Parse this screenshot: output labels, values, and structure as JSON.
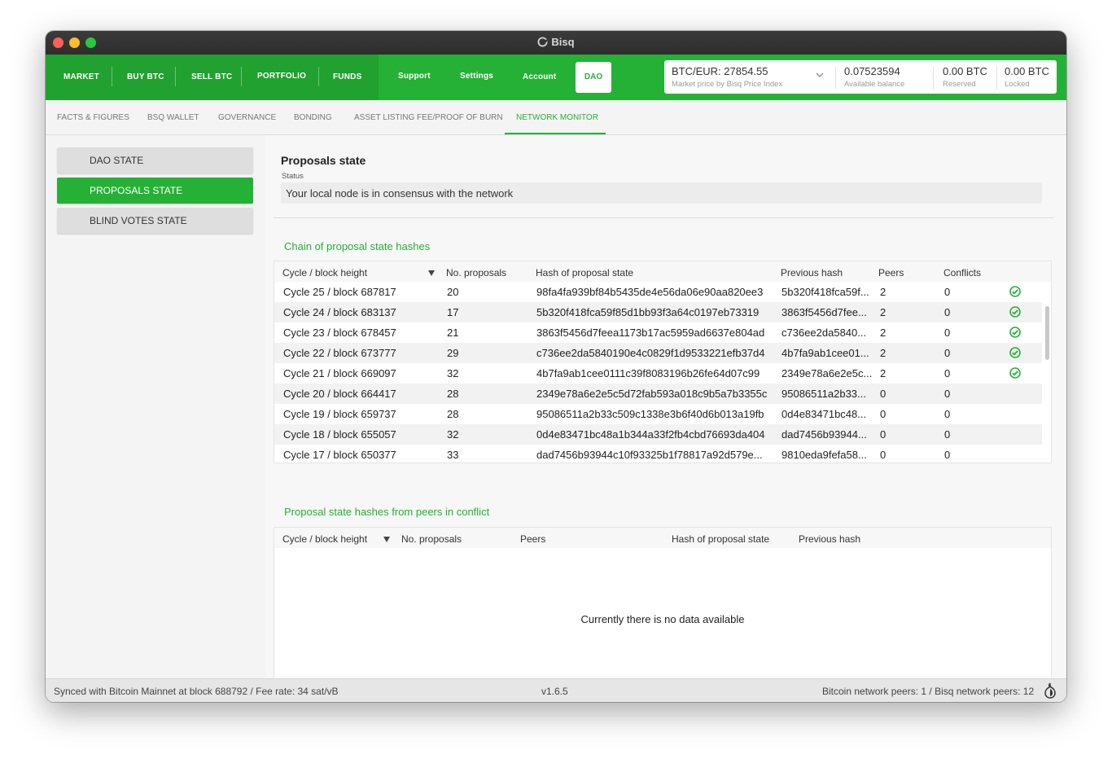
{
  "window": {
    "title": "Bisq"
  },
  "nav": {
    "market": "MARKET",
    "buy": "BUY BTC",
    "sell": "SELL BTC",
    "portfolio": "PORTFOLIO",
    "funds": "FUNDS",
    "support": "Support",
    "settings": "Settings",
    "account": "Account",
    "dao": "DAO"
  },
  "balance": {
    "price": "BTC/EUR: 27854.55",
    "price_sub": "Market price by Bisq Price Index",
    "available": "0.07523594",
    "available_sub": "Available balance",
    "reserved": "0.00 BTC",
    "reserved_sub": "Reserved",
    "locked": "0.00 BTC",
    "locked_sub": "Locked"
  },
  "subtabs": [
    "FACTS & FIGURES",
    "BSQ WALLET",
    "GOVERNANCE",
    "BONDING",
    "ASSET LISTING FEE/PROOF OF BURN",
    "NETWORK MONITOR"
  ],
  "sidebar": [
    "DAO STATE",
    "PROPOSALS STATE",
    "BLIND VOTES STATE"
  ],
  "main": {
    "title": "Proposals state",
    "status_label": "Status",
    "status_value": "Your local node is in consensus with the network",
    "chain_title": "Chain of proposal state hashes",
    "conflict_title": "Proposal state hashes from peers in conflict",
    "empty": "Currently there is no data available"
  },
  "chain_table": {
    "headers": [
      "Cycle / block height",
      "No. proposals",
      "Hash of proposal state",
      "Previous hash",
      "Peers",
      "Conflicts"
    ],
    "rows": [
      [
        "Cycle 25 / block 687817",
        "20",
        "98fa4fa939bf84b5435de4e56da06e90aa820ee3",
        "5b320f418fca59f...",
        "2",
        "0"
      ],
      [
        "Cycle 24 / block 683137",
        "17",
        "5b320f418fca59f85d1bb93f3a64c0197eb73319",
        "3863f5456d7fee...",
        "2",
        "0"
      ],
      [
        "Cycle 23 / block 678457",
        "21",
        "3863f5456d7feea1173b17ac5959ad6637e804ad",
        "c736ee2da5840...",
        "2",
        "0"
      ],
      [
        "Cycle 22 / block 673777",
        "29",
        "c736ee2da5840190e4c0829f1d9533221efb37d4",
        "4b7fa9ab1cee01...",
        "2",
        "0"
      ],
      [
        "Cycle 21 / block 669097",
        "32",
        "4b7fa9ab1cee0111c39f8083196b26fe64d07c99",
        "2349e78a6e2e5c...",
        "2",
        "0"
      ],
      [
        "Cycle 20 / block 664417",
        "28",
        "2349e78a6e2e5c5d72fab593a018c9b5a7b3355c",
        "95086511a2b33...",
        "0",
        "0"
      ],
      [
        "Cycle 19 / block 659737",
        "28",
        "95086511a2b33c509c1338e3b6f40d6b013a19fb",
        "0d4e83471bc48...",
        "0",
        "0"
      ],
      [
        "Cycle 18 / block 655057",
        "32",
        "0d4e83471bc48a1b344a33f2fb4cbd76693da404",
        "dad7456b93944...",
        "0",
        "0"
      ],
      [
        "Cycle 17 / block 650377",
        "33",
        "dad7456b93944c10f93325b1f78817a92d579e...",
        "9810eda9fefa58...",
        "0",
        "0"
      ]
    ]
  },
  "conflict_table": {
    "headers": [
      "Cycle / block height",
      "No. proposals",
      "Peers",
      "Hash of proposal state",
      "Previous hash"
    ]
  },
  "footer": {
    "sync": "Synced with Bitcoin Mainnet at block 688792 / Fee rate: 34 sat/vB",
    "version": "v1.6.5",
    "peers": "Bitcoin network peers: 1 / Bisq network peers: 12"
  },
  "colors": {
    "accent": "#25b135",
    "accent_dark": "#21a130"
  }
}
